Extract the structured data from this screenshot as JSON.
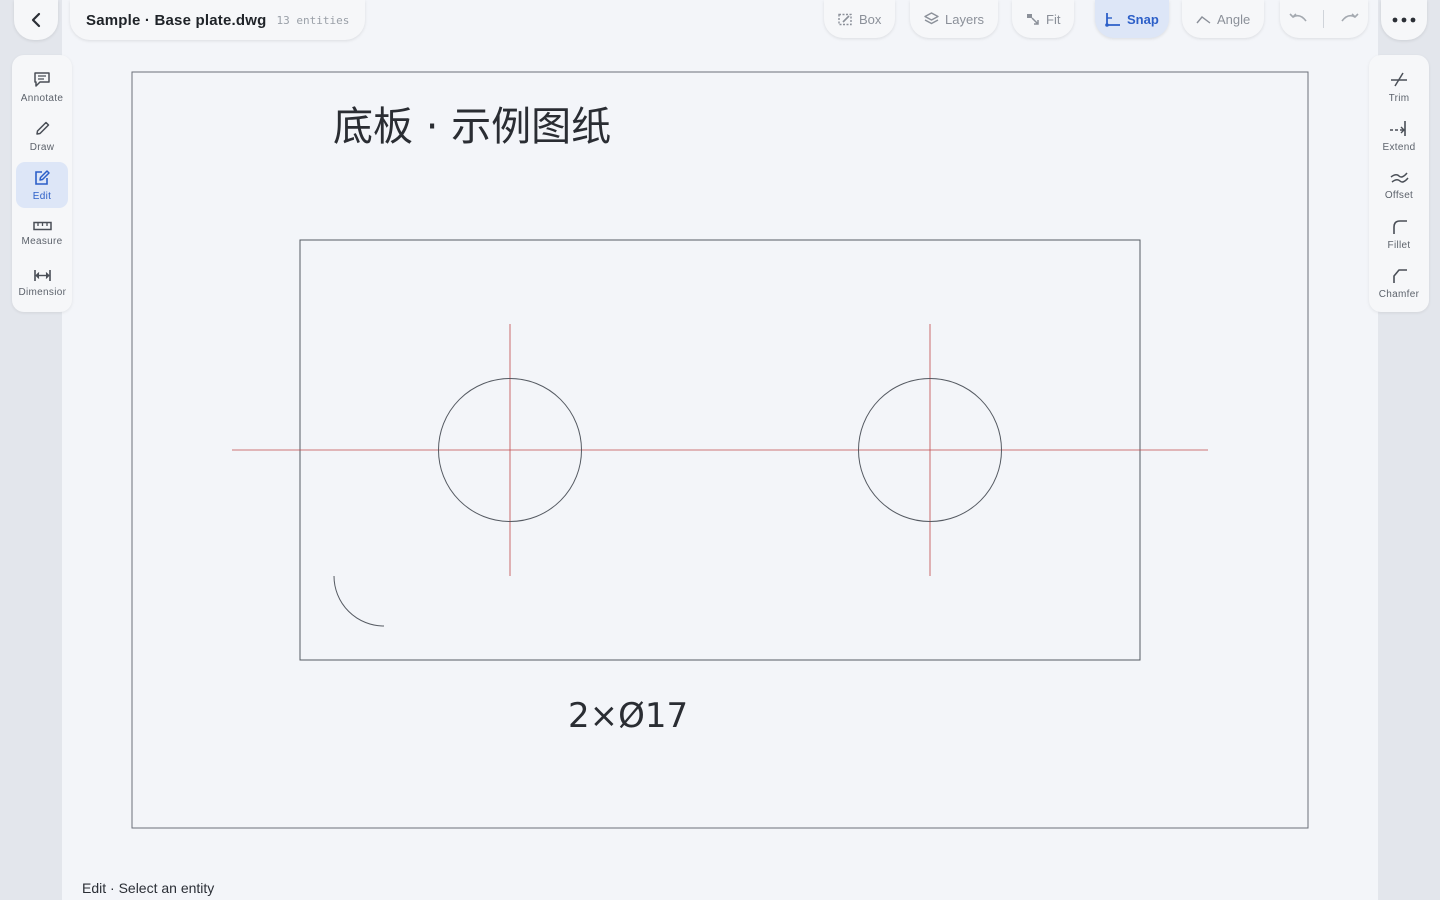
{
  "header": {
    "title": "Sample · Base plate.dwg",
    "entity_count": "13 entities",
    "tools": [
      {
        "label": "Box",
        "icon": "box-select-icon",
        "active": false
      },
      {
        "label": "Layers",
        "icon": "layers-icon",
        "active": false
      },
      {
        "label": "Fit",
        "icon": "fit-icon",
        "active": false
      },
      {
        "label": "Snap",
        "icon": "snap-icon",
        "active": true
      },
      {
        "label": "Angle",
        "icon": "angle-icon",
        "active": false
      }
    ]
  },
  "left_toolbar": [
    {
      "label": "Annotate",
      "icon": "annotate-icon",
      "active": false
    },
    {
      "label": "Draw",
      "icon": "pencil-icon",
      "active": false
    },
    {
      "label": "Edit",
      "icon": "edit-icon",
      "active": true
    },
    {
      "label": "Measure",
      "icon": "ruler-icon",
      "active": false
    },
    {
      "label": "Dimension",
      "icon": "dimension-icon",
      "active": false
    }
  ],
  "right_toolbar": [
    {
      "label": "Trim",
      "icon": "trim-icon"
    },
    {
      "label": "Extend",
      "icon": "extend-icon"
    },
    {
      "label": "Offset",
      "icon": "offset-icon"
    },
    {
      "label": "Fillet",
      "icon": "fillet-icon"
    },
    {
      "label": "Chamfer",
      "icon": "chamfer-icon"
    }
  ],
  "drawing": {
    "title": "底板 · 示例图纸",
    "dimension_label": "2×Ø17"
  },
  "status": "Edit · Select an entity",
  "colors": {
    "accent": "#2c5fc8",
    "accent_bg": "#dde6f7",
    "centerline": "#c04a4a",
    "geometry": "#555a62"
  }
}
